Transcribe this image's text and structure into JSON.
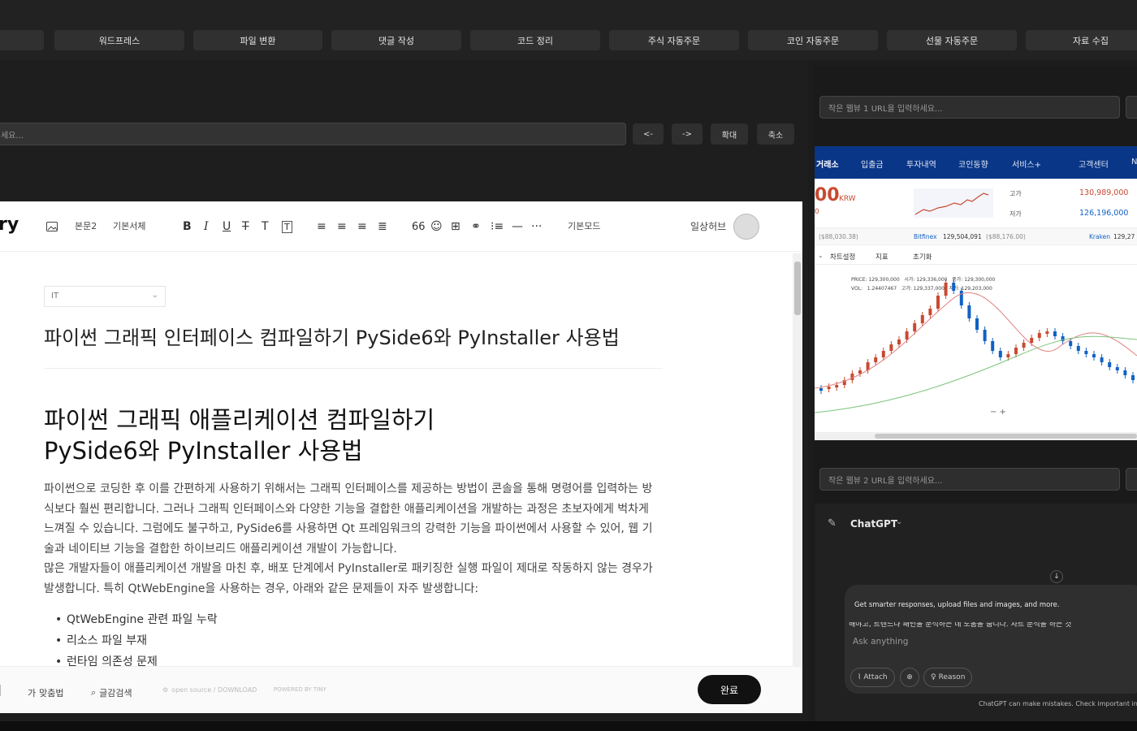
{
  "nav": {
    "items": [
      "워드프레스",
      "파일 변환",
      "댓글 작성",
      "코드 정리",
      "주식 자동주문",
      "코인 자동주문",
      "선물 자동주문",
      "자료 수집"
    ]
  },
  "urlbar": {
    "placeholder": "세요...",
    "back": "<-",
    "forward": "->",
    "zoom_in": "확대",
    "zoom_out": "축소"
  },
  "editor": {
    "logo": "ry",
    "toolbar": {
      "style": "본문2",
      "font": "기본서체",
      "mode": "기본모드",
      "quote": "66",
      "more": "···"
    },
    "blog_name": "일상허브",
    "category": "IT",
    "title": "파이썬 그래픽 인터페이스 컴파일하기  PySide6와 PyInstaller 사용법",
    "heading_line1": "파이썬 그래픽 애플리케이션 컴파일하기",
    "heading_line2": "PySide6와 PyInstaller 사용법",
    "paragraph1": "파이썬으로 코딩한 후 이를 간편하게 사용하기 위해서는 그래픽 인터페이스를 제공하는 방법이 콘솔을 통해 명령어를 입력하는 방식보다 훨씬 편리합니다. 그러나 그래픽 인터페이스와 다양한 기능을 결합한 애플리케이션을 개발하는 과정은 초보자에게 벅차게 느껴질 수 있습니다. 그럼에도 불구하고, PySide6를 사용하면 Qt 프레임워크의 강력한 기능을 파이썬에서 사용할 수 있어, 웹 기술과 네이티브 기능을 결합한 하이브리드 애플리케이션 개발이 가능합니다.",
    "paragraph2": "많은 개발자들이 애플리케이션 개발을 마친 후, 배포 단계에서 PyInstaller로 패키징한 실행 파일이 제대로 작동하지 않는 경우가 발생합니다. 특히 QtWebEngine을 사용하는 경우, 아래와 같은 문제들이 자주 발생합니다:",
    "bullets": [
      "QtWebEngine 관련 파일 누락",
      "리소스 파일 부재",
      "런타임 의존성 문제"
    ],
    "footer": {
      "spell": "맞춤법",
      "search": "글감검색",
      "opensource": "open source / DOWNLOAD",
      "powered": "POWERED BY TINY",
      "done": "완료"
    }
  },
  "right": {
    "url1_placeholder": "작은 웹뷰 1 URL을 입력하세요...",
    "url2_placeholder": "작은 웹뷰 2 URL을 입력하세요...",
    "trade": {
      "nav": [
        "거래소",
        "입출금",
        "투자내역",
        "코인동향",
        "서비스+",
        "고객센터",
        "N"
      ],
      "price_partial": "00",
      "price_unit": "KRW",
      "price_sub": "0",
      "high_label": "고가",
      "high": "130,989,000",
      "low_label": "저가",
      "low": "126,196,000",
      "ref1": "($88,030.38)",
      "bitfinex_label": "Bitfinex",
      "bitfinex": "129,504,091",
      "bitfinex_usd": "($88,176.00)",
      "kraken_label": "Kraken",
      "kraken": "129,27",
      "chart_settings": "차트설정",
      "indicator": "지표",
      "reset": "초기화",
      "info1": "PRICE: 129,300,000   시가: 129,336,000   종가: 129,300,000",
      "info2": "VOL:   1.24407467   고가: 129,337,000   저가: 129,203,000",
      "zoom": "− +"
    },
    "gpt": {
      "model": "ChatGPT",
      "promo": "Get smarter responses, upload files and images, and more.",
      "cut_text": "해야고, 트렌드나 패턴을 분석하는 데 도움을 줍니다. 차트 분석을 하는 것",
      "placeholder": "Ask anything",
      "attach": "Attach",
      "reason": "Reason",
      "disclaimer": "ChatGPT can make mistakes. Check important info."
    }
  },
  "colors": {
    "upbit_blue": "#093687",
    "rise": "#c84a31",
    "fall": "#1261c4"
  }
}
